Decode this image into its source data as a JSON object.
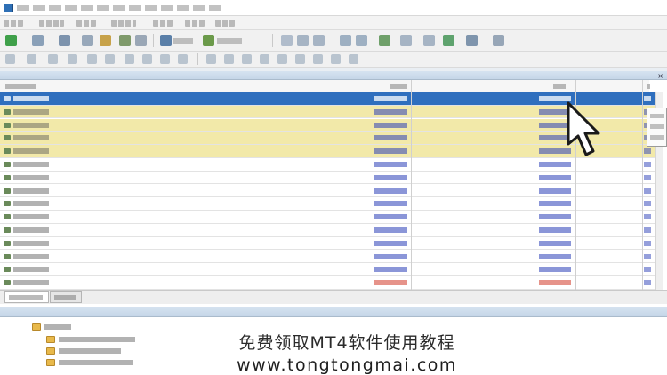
{
  "window": {
    "title": "",
    "accent": "#2f6fbe"
  },
  "menu": {
    "items": [
      "",
      "",
      "",
      "",
      "",
      "",
      "",
      ""
    ]
  },
  "market_watch": {
    "panel_title": "",
    "columns": {
      "symbol": "",
      "bid": "",
      "ask": "",
      "spread": ""
    },
    "row_states": [
      "selected",
      "highlight",
      "highlight",
      "highlight",
      "highlight",
      "normal",
      "normal",
      "normal",
      "normal",
      "normal",
      "normal",
      "normal",
      "normal",
      "normal",
      "down"
    ],
    "tabs": [
      "",
      ""
    ]
  },
  "navigator": {
    "panel_title": "",
    "items": [
      "",
      "",
      "",
      ""
    ]
  },
  "icons": [
    "app-icon",
    "new-order-icon",
    "chart-icon",
    "folder-icon",
    "mouse-pointer-icon"
  ],
  "overlay_caption": {
    "line1": "免费领取MT4软件使用教程",
    "line2": "www.tongtongmai.com"
  }
}
